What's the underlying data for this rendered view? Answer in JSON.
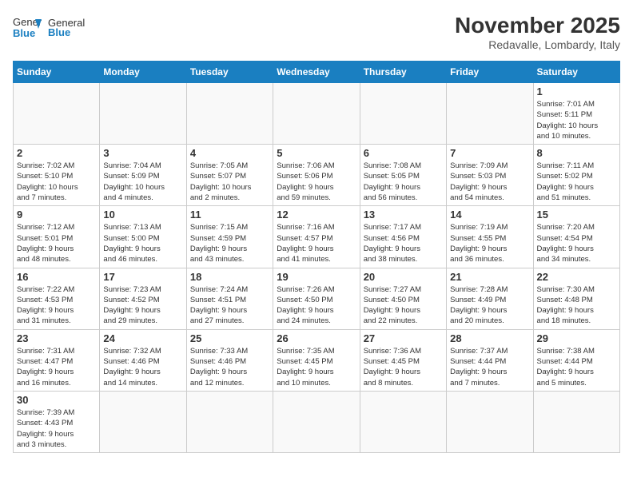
{
  "header": {
    "logo_general": "General",
    "logo_blue": "Blue",
    "month": "November 2025",
    "location": "Redavalle, Lombardy, Italy"
  },
  "weekdays": [
    "Sunday",
    "Monday",
    "Tuesday",
    "Wednesday",
    "Thursday",
    "Friday",
    "Saturday"
  ],
  "weeks": [
    {
      "days": [
        {
          "num": "",
          "info": ""
        },
        {
          "num": "",
          "info": ""
        },
        {
          "num": "",
          "info": ""
        },
        {
          "num": "",
          "info": ""
        },
        {
          "num": "",
          "info": ""
        },
        {
          "num": "",
          "info": ""
        },
        {
          "num": "1",
          "info": "Sunrise: 7:01 AM\nSunset: 5:11 PM\nDaylight: 10 hours\nand 10 minutes."
        }
      ]
    },
    {
      "days": [
        {
          "num": "2",
          "info": "Sunrise: 7:02 AM\nSunset: 5:10 PM\nDaylight: 10 hours\nand 7 minutes."
        },
        {
          "num": "3",
          "info": "Sunrise: 7:04 AM\nSunset: 5:09 PM\nDaylight: 10 hours\nand 4 minutes."
        },
        {
          "num": "4",
          "info": "Sunrise: 7:05 AM\nSunset: 5:07 PM\nDaylight: 10 hours\nand 2 minutes."
        },
        {
          "num": "5",
          "info": "Sunrise: 7:06 AM\nSunset: 5:06 PM\nDaylight: 9 hours\nand 59 minutes."
        },
        {
          "num": "6",
          "info": "Sunrise: 7:08 AM\nSunset: 5:05 PM\nDaylight: 9 hours\nand 56 minutes."
        },
        {
          "num": "7",
          "info": "Sunrise: 7:09 AM\nSunset: 5:03 PM\nDaylight: 9 hours\nand 54 minutes."
        },
        {
          "num": "8",
          "info": "Sunrise: 7:11 AM\nSunset: 5:02 PM\nDaylight: 9 hours\nand 51 minutes."
        }
      ]
    },
    {
      "days": [
        {
          "num": "9",
          "info": "Sunrise: 7:12 AM\nSunset: 5:01 PM\nDaylight: 9 hours\nand 48 minutes."
        },
        {
          "num": "10",
          "info": "Sunrise: 7:13 AM\nSunset: 5:00 PM\nDaylight: 9 hours\nand 46 minutes."
        },
        {
          "num": "11",
          "info": "Sunrise: 7:15 AM\nSunset: 4:59 PM\nDaylight: 9 hours\nand 43 minutes."
        },
        {
          "num": "12",
          "info": "Sunrise: 7:16 AM\nSunset: 4:57 PM\nDaylight: 9 hours\nand 41 minutes."
        },
        {
          "num": "13",
          "info": "Sunrise: 7:17 AM\nSunset: 4:56 PM\nDaylight: 9 hours\nand 38 minutes."
        },
        {
          "num": "14",
          "info": "Sunrise: 7:19 AM\nSunset: 4:55 PM\nDaylight: 9 hours\nand 36 minutes."
        },
        {
          "num": "15",
          "info": "Sunrise: 7:20 AM\nSunset: 4:54 PM\nDaylight: 9 hours\nand 34 minutes."
        }
      ]
    },
    {
      "days": [
        {
          "num": "16",
          "info": "Sunrise: 7:22 AM\nSunset: 4:53 PM\nDaylight: 9 hours\nand 31 minutes."
        },
        {
          "num": "17",
          "info": "Sunrise: 7:23 AM\nSunset: 4:52 PM\nDaylight: 9 hours\nand 29 minutes."
        },
        {
          "num": "18",
          "info": "Sunrise: 7:24 AM\nSunset: 4:51 PM\nDaylight: 9 hours\nand 27 minutes."
        },
        {
          "num": "19",
          "info": "Sunrise: 7:26 AM\nSunset: 4:50 PM\nDaylight: 9 hours\nand 24 minutes."
        },
        {
          "num": "20",
          "info": "Sunrise: 7:27 AM\nSunset: 4:50 PM\nDaylight: 9 hours\nand 22 minutes."
        },
        {
          "num": "21",
          "info": "Sunrise: 7:28 AM\nSunset: 4:49 PM\nDaylight: 9 hours\nand 20 minutes."
        },
        {
          "num": "22",
          "info": "Sunrise: 7:30 AM\nSunset: 4:48 PM\nDaylight: 9 hours\nand 18 minutes."
        }
      ]
    },
    {
      "days": [
        {
          "num": "23",
          "info": "Sunrise: 7:31 AM\nSunset: 4:47 PM\nDaylight: 9 hours\nand 16 minutes."
        },
        {
          "num": "24",
          "info": "Sunrise: 7:32 AM\nSunset: 4:46 PM\nDaylight: 9 hours\nand 14 minutes."
        },
        {
          "num": "25",
          "info": "Sunrise: 7:33 AM\nSunset: 4:46 PM\nDaylight: 9 hours\nand 12 minutes."
        },
        {
          "num": "26",
          "info": "Sunrise: 7:35 AM\nSunset: 4:45 PM\nDaylight: 9 hours\nand 10 minutes."
        },
        {
          "num": "27",
          "info": "Sunrise: 7:36 AM\nSunset: 4:45 PM\nDaylight: 9 hours\nand 8 minutes."
        },
        {
          "num": "28",
          "info": "Sunrise: 7:37 AM\nSunset: 4:44 PM\nDaylight: 9 hours\nand 7 minutes."
        },
        {
          "num": "29",
          "info": "Sunrise: 7:38 AM\nSunset: 4:44 PM\nDaylight: 9 hours\nand 5 minutes."
        }
      ]
    },
    {
      "days": [
        {
          "num": "30",
          "info": "Sunrise: 7:39 AM\nSunset: 4:43 PM\nDaylight: 9 hours\nand 3 minutes."
        },
        {
          "num": "",
          "info": ""
        },
        {
          "num": "",
          "info": ""
        },
        {
          "num": "",
          "info": ""
        },
        {
          "num": "",
          "info": ""
        },
        {
          "num": "",
          "info": ""
        },
        {
          "num": "",
          "info": ""
        }
      ]
    }
  ]
}
